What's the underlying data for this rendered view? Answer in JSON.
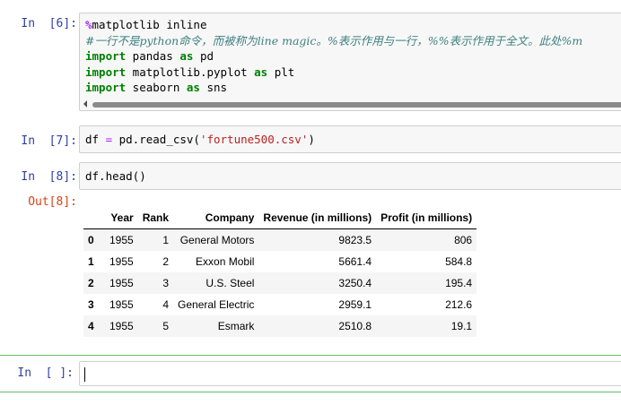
{
  "cells": [
    {
      "prompt": "In  [6]:",
      "lines": [
        [
          {
            "t": "%",
            "c": "mg"
          },
          {
            "t": "matplotlib inline"
          }
        ],
        [
          {
            "t": "#一行不是python命令，而被称为line magic。%表示作用与一行，%%表示作用于全文。此处%m",
            "c": "cm"
          }
        ],
        [
          {
            "t": "import",
            "c": "kw"
          },
          {
            "t": " pandas "
          },
          {
            "t": "as",
            "c": "kw"
          },
          {
            "t": " pd"
          }
        ],
        [
          {
            "t": "import",
            "c": "kw"
          },
          {
            "t": " matplotlib.pyplot "
          },
          {
            "t": "as",
            "c": "kw"
          },
          {
            "t": " plt"
          }
        ],
        [
          {
            "t": "import",
            "c": "kw"
          },
          {
            "t": " seaborn "
          },
          {
            "t": "as",
            "c": "kw"
          },
          {
            "t": " sns"
          }
        ]
      ]
    },
    {
      "prompt": "In  [7]:",
      "lines": [
        [
          {
            "t": "df "
          },
          {
            "t": "=",
            "c": "op"
          },
          {
            "t": " pd.read_csv("
          },
          {
            "t": "'fortune500.csv'",
            "c": "str"
          },
          {
            "t": ")"
          }
        ]
      ]
    },
    {
      "prompt": "In  [8]:",
      "lines": [
        [
          {
            "t": "df.head()"
          }
        ]
      ]
    }
  ],
  "output": {
    "prompt": "Out[8]:",
    "columns": [
      "",
      "Year",
      "Rank",
      "Company",
      "Revenue (in millions)",
      "Profit (in millions)"
    ],
    "rows": [
      [
        "0",
        "1955",
        "1",
        "General Motors",
        "9823.5",
        "806"
      ],
      [
        "1",
        "1955",
        "2",
        "Exxon Mobil",
        "5661.4",
        "584.8"
      ],
      [
        "2",
        "1955",
        "3",
        "U.S. Steel",
        "3250.4",
        "195.4"
      ],
      [
        "3",
        "1955",
        "4",
        "General Electric",
        "2959.1",
        "212.6"
      ],
      [
        "4",
        "1955",
        "5",
        "Esmark",
        "2510.8",
        "19.1"
      ]
    ]
  },
  "empty_cell": {
    "prompt": "In  [ ]:",
    "value": ""
  }
}
